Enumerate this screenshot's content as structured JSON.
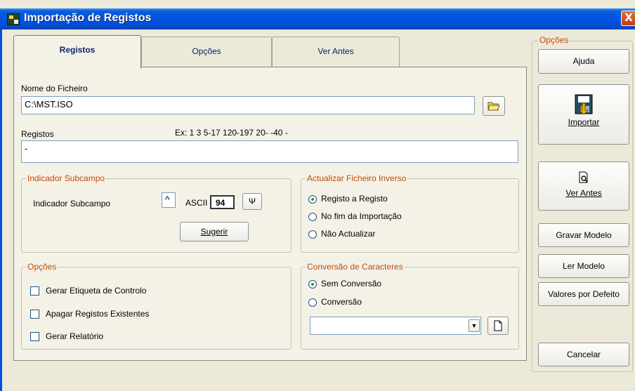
{
  "window": {
    "title": "Importação de Registos",
    "close_label": "X"
  },
  "tabs": [
    {
      "label": "Registos",
      "active": true
    },
    {
      "label": "Opções",
      "active": false
    },
    {
      "label": "Ver Antes",
      "active": false
    }
  ],
  "file": {
    "label": "Nome do Ficheiro",
    "value": "C:\\MST.ISO",
    "browse_icon": "folder-open-icon"
  },
  "records": {
    "label": "Registos",
    "example": "Ex: 1  3  5-17 120-197 20-  -40  -",
    "value": "-"
  },
  "subfield": {
    "group_title": "Indicador Subcampo",
    "label": "Indicador Subcampo",
    "char": "^",
    "ascii_label": "ASCII",
    "ascii_value": "94",
    "symbol": "Ψ",
    "suggest_button": "Sugerir"
  },
  "inverted": {
    "group_title": "Actualizar Ficheiro Inverso",
    "options": [
      "Registo a Registo",
      "No fim da Importação",
      "Não Actualizar"
    ],
    "selected": 0
  },
  "options_group": {
    "group_title": "Opções",
    "checks": [
      "Gerar Etiqueta de Controlo",
      "Apagar Registos Existentes",
      "Gerar Relatório"
    ]
  },
  "conversion": {
    "group_title": "Conversão de Caracteres",
    "options": [
      "Sem Conversão",
      "Conversão"
    ],
    "selected": 0,
    "select_value": ""
  },
  "sidebar": {
    "group_title": "Opções",
    "help": "Ajuda",
    "import": "Importar",
    "preview": "Ver Antes",
    "save_model": "Gravar Modelo",
    "load_model": "Ler Modelo",
    "defaults": "Valores por Defeito",
    "cancel": "Cancelar"
  },
  "colors": {
    "titlebar": "#0054e3",
    "group_title": "#c24b07",
    "window_bg": "#ece9d8"
  }
}
